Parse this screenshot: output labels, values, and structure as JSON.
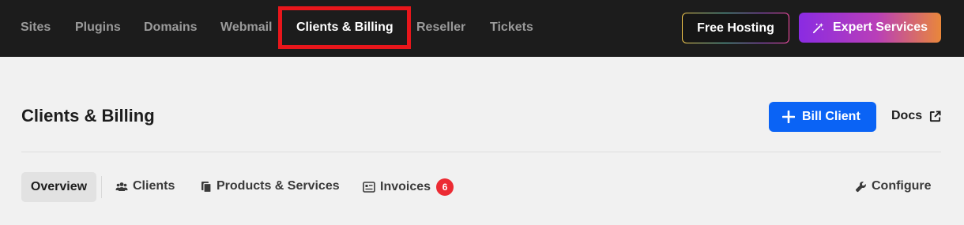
{
  "nav": {
    "items": [
      "Sites",
      "Plugins",
      "Domains",
      "Webmail",
      "Clients & Billing",
      "Reseller",
      "Tickets"
    ],
    "active": "Clients & Billing",
    "free_hosting": "Free Hosting",
    "expert_services": "Expert Services"
  },
  "header": {
    "title": "Clients & Billing",
    "bill_client": "Bill Client",
    "docs": "Docs"
  },
  "tabs": {
    "overview": "Overview",
    "clients": "Clients",
    "products": "Products & Services",
    "invoices": "Invoices",
    "invoices_count": "6",
    "configure": "Configure"
  },
  "colors": {
    "topbar": "#1c1c1c",
    "highlight": "#e8161b",
    "primary": "#0a63f5",
    "badge": "#ec2b33"
  }
}
